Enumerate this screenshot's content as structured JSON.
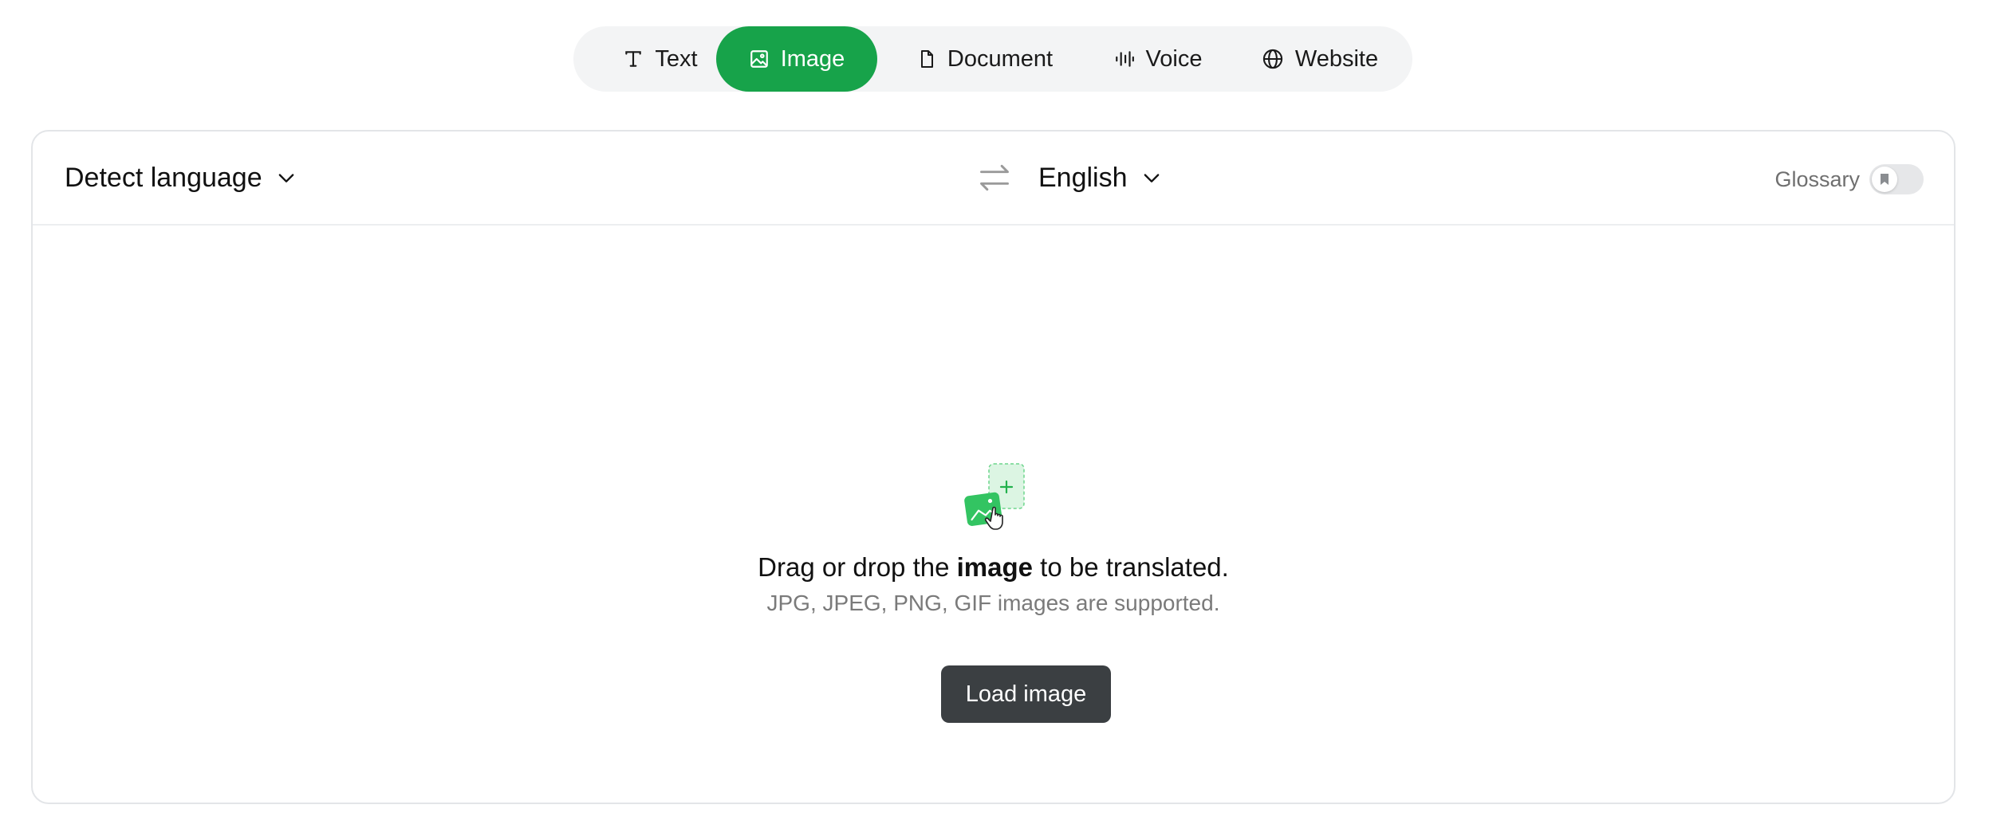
{
  "mode_tabs": {
    "items": [
      {
        "label": "Text",
        "icon": "text-icon"
      },
      {
        "label": "Image",
        "icon": "image-icon",
        "active": true
      },
      {
        "label": "Document",
        "icon": "document-icon"
      },
      {
        "label": "Voice",
        "icon": "voice-icon"
      },
      {
        "label": "Website",
        "icon": "globe-icon"
      }
    ]
  },
  "languages": {
    "source": "Detect language",
    "target": "English"
  },
  "glossary": {
    "label": "Glossary",
    "enabled": false
  },
  "dropzone": {
    "title_before": "Drag or drop the ",
    "title_bold": "image",
    "title_after": " to be translated.",
    "subtitle": "JPG, JPEG, PNG, GIF images are supported.",
    "button_label": "Load image"
  },
  "colors": {
    "accent": "#17a34a",
    "button_dark": "#3b3f42",
    "tabs_background": "#f3f4f5"
  }
}
